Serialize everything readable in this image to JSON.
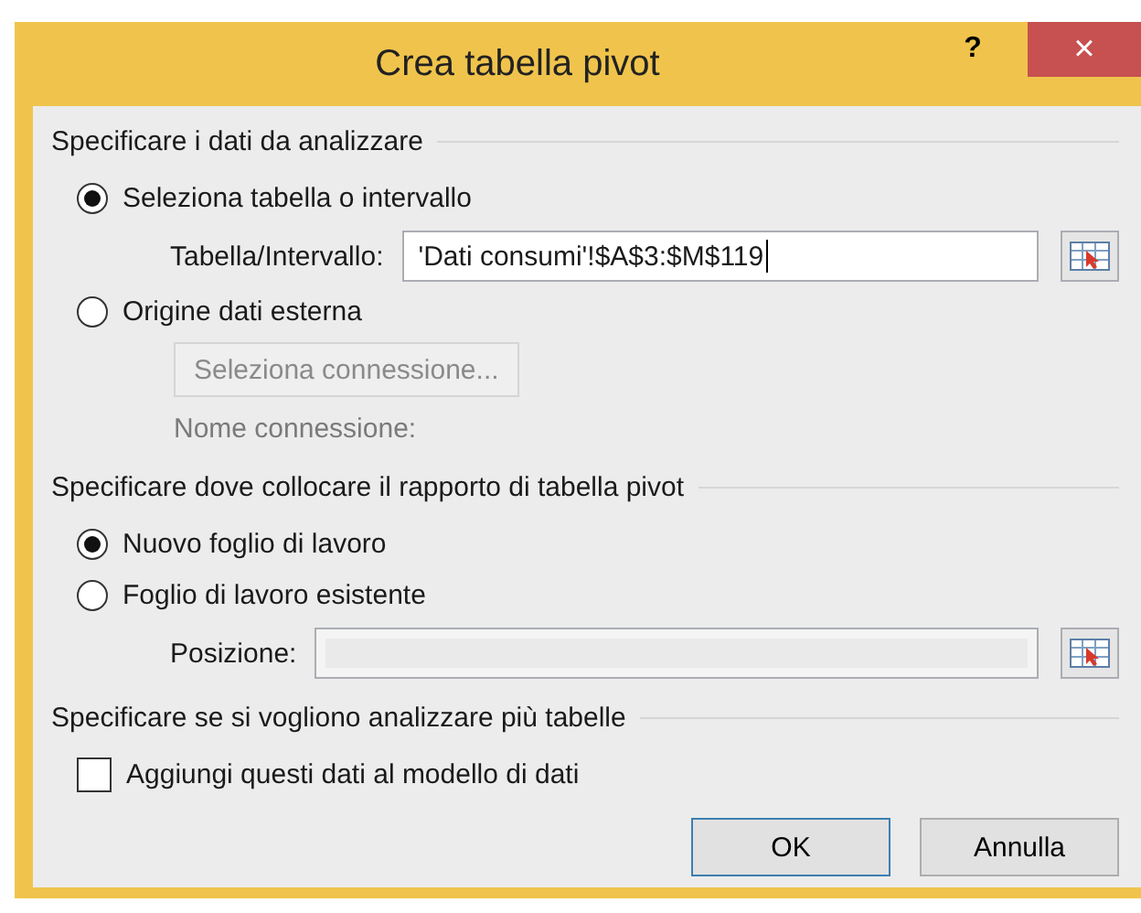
{
  "window": {
    "title": "Crea tabella pivot",
    "help_button": "?",
    "close_button": "×"
  },
  "sections": [
    {
      "heading": "Specificare i dati da analizzare",
      "items": [
        {
          "kind": "radio",
          "label": "Seleziona tabella o intervallo",
          "selected": true
        },
        {
          "kind": "field",
          "label": "Tabella/Intervallo:",
          "value": "'Dati consumi'!$A$3:$M$119",
          "disabled": false
        },
        {
          "kind": "radio",
          "label": "Origine dati esterna",
          "selected": false
        },
        {
          "kind": "button",
          "label": "Seleziona connessione...",
          "disabled": true
        },
        {
          "kind": "label",
          "label": "Nome connessione:",
          "disabled": true
        }
      ]
    },
    {
      "heading": "Specificare dove collocare il rapporto di tabella pivot",
      "items": [
        {
          "kind": "radio",
          "label": "Nuovo foglio di lavoro",
          "selected": true
        },
        {
          "kind": "radio",
          "label": "Foglio di lavoro esistente",
          "selected": false
        },
        {
          "kind": "field",
          "label": "Posizione:",
          "disabled": true
        }
      ]
    },
    {
      "heading": "Specificare se si vogliono analizzare più tabelle",
      "items": [
        {
          "kind": "checkbox",
          "label": "Aggiungi questi dati al modello di dati",
          "checked": false
        }
      ]
    }
  ],
  "buttons": [
    {
      "label": "OK",
      "default": true
    },
    {
      "label": "Annulla",
      "default": false
    }
  ]
}
